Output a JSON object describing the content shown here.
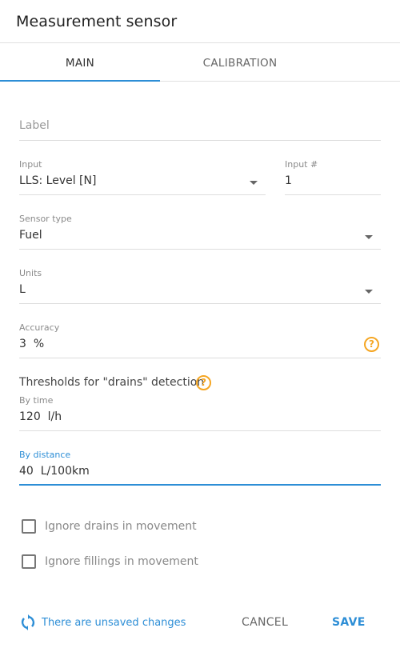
{
  "dialog": {
    "title": "Measurement sensor"
  },
  "tabs": [
    {
      "label": "MAIN",
      "active": true
    },
    {
      "label": "CALIBRATION",
      "active": false
    }
  ],
  "form": {
    "label": {
      "placeholder": "Label",
      "value": ""
    },
    "input": {
      "label": "Input",
      "value": "LLS: Level [N]"
    },
    "input_number": {
      "label": "Input #",
      "value": "1"
    },
    "sensor_type": {
      "label": "Sensor type",
      "value": "Fuel"
    },
    "units": {
      "label": "Units",
      "value": "L"
    },
    "accuracy": {
      "label": "Accuracy",
      "value": "3",
      "unit": "%"
    },
    "thresholds": {
      "title": "Thresholds for \"drains\" detection",
      "by_time": {
        "label": "By time",
        "value": "120",
        "unit": "l/h"
      },
      "by_distance": {
        "label": "By distance",
        "value": "40",
        "unit": "L/100km"
      }
    },
    "checkboxes": [
      {
        "label": "Ignore drains in movement",
        "checked": false
      },
      {
        "label": "Ignore fillings in movement",
        "checked": false
      }
    ]
  },
  "footer": {
    "status": "There are unsaved changes",
    "cancel_label": "CANCEL",
    "save_label": "SAVE"
  },
  "icons": {
    "help": "?",
    "sync": "sync-icon",
    "caret": "caret-down-icon"
  },
  "colors": {
    "accent": "#2d8ed6",
    "help": "#f5a623"
  }
}
